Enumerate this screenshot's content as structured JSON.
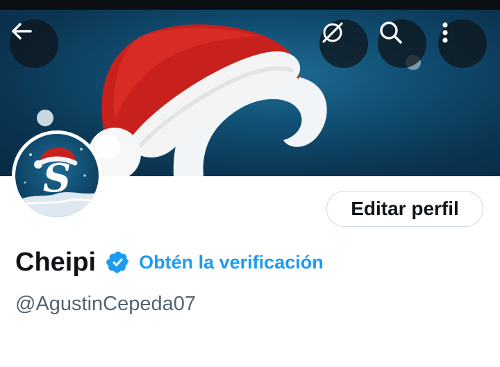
{
  "header": {
    "back_icon": "arrow-left-icon",
    "actions": [
      "grok-icon",
      "search-icon",
      "more-vertical-icon"
    ]
  },
  "profile": {
    "display_name": "Cheipi",
    "verified_badge_color": "#1d9bf0",
    "verify_link": "Obtén la verificación",
    "handle": "@AgustinCepeda07",
    "edit_button": "Editar perfil",
    "avatar_letter": "S"
  },
  "colors": {
    "accent": "#1d9bf0",
    "text_primary": "#0f1419",
    "text_secondary": "#536471",
    "banner": "#114f73"
  }
}
